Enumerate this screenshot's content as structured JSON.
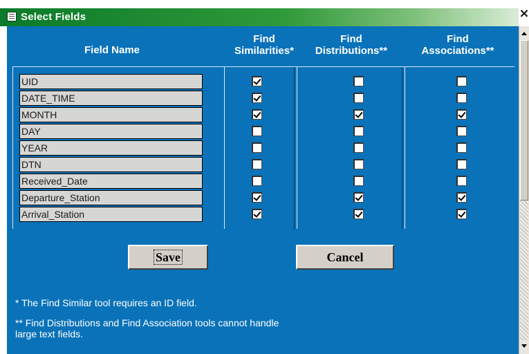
{
  "window": {
    "title": "Select Fields",
    "close_glyph": "×"
  },
  "headers": {
    "field_name": "Field Name",
    "find_similarities": [
      "Find",
      "Similarities*"
    ],
    "find_distributions": [
      "Find",
      "Distributions**"
    ],
    "find_associations": [
      "Find",
      "Associations**"
    ]
  },
  "fields": [
    {
      "name": "UID",
      "similarities": true,
      "distributions": false,
      "associations": false
    },
    {
      "name": "DATE_TIME",
      "similarities": true,
      "distributions": false,
      "associations": false
    },
    {
      "name": "MONTH",
      "similarities": true,
      "distributions": true,
      "associations": true
    },
    {
      "name": "DAY",
      "similarities": false,
      "distributions": false,
      "associations": false
    },
    {
      "name": "YEAR",
      "similarities": false,
      "distributions": false,
      "associations": false
    },
    {
      "name": "DTN",
      "similarities": false,
      "distributions": false,
      "associations": false
    },
    {
      "name": "Received_Date",
      "similarities": false,
      "distributions": false,
      "associations": false
    },
    {
      "name": "Departure_Station",
      "similarities": true,
      "distributions": true,
      "associations": true
    },
    {
      "name": "Arrival_Station",
      "similarities": true,
      "distributions": true,
      "associations": true
    }
  ],
  "buttons": {
    "save": "Save",
    "cancel": "Cancel"
  },
  "notes": [
    "* The Find Similar tool requires an ID field.",
    "** Find Distributions and Find Association tools cannot handle large text fields."
  ],
  "colors": {
    "panel": "#0a72b8",
    "titlebar": "#0b7a2a",
    "field_bg": "#d6d6d4"
  },
  "icons": {
    "app": "form-icon",
    "close": "close-icon",
    "scroll_up": "scroll-up-arrow-icon",
    "scroll_down": "scroll-down-arrow-icon"
  }
}
